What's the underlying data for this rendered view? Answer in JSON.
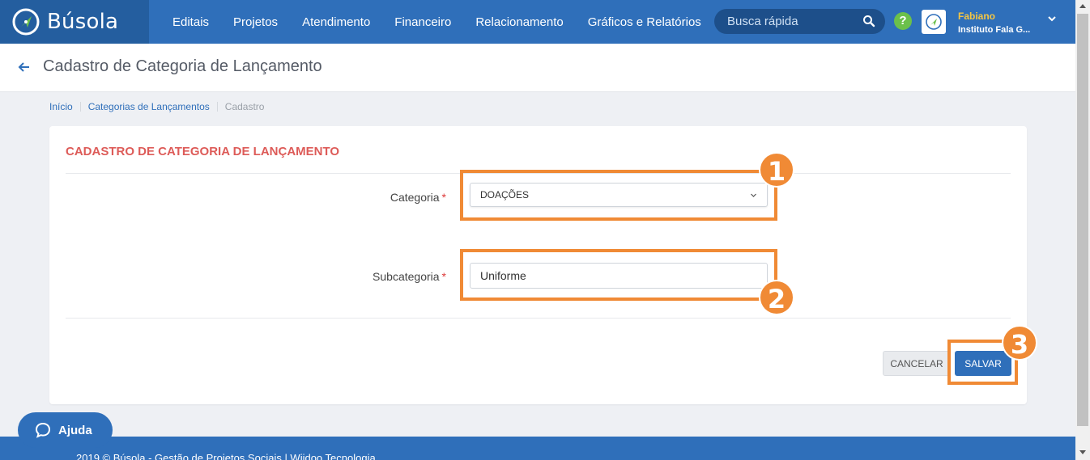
{
  "app": {
    "name": "Búsola"
  },
  "nav": {
    "items": [
      {
        "label": "Editais"
      },
      {
        "label": "Projetos"
      },
      {
        "label": "Atendimento"
      },
      {
        "label": "Financeiro"
      },
      {
        "label": "Relacionamento"
      },
      {
        "label": "Gráficos e Relatórios"
      }
    ]
  },
  "search": {
    "placeholder": "Busca rápida"
  },
  "user": {
    "name": "Fabiano",
    "org": "Instituto Fala G..."
  },
  "page": {
    "title": "Cadastro de Categoria de Lançamento"
  },
  "breadcrumb": [
    {
      "label": "Início"
    },
    {
      "label": "Categorias de Lançamentos"
    },
    {
      "label": "Cadastro"
    }
  ],
  "form": {
    "heading": "CADASTRO DE CATEGORIA DE LANÇAMENTO",
    "categoria": {
      "label": "Categoria",
      "required_mark": "*",
      "value": "DOAÇÕES"
    },
    "subcategoria": {
      "label": "Subcategoria",
      "required_mark": "*",
      "value": "Uniforme"
    },
    "cancel_label": "CANCELAR",
    "save_label": "SALVAR"
  },
  "annotations": {
    "n1": "1",
    "n2": "2",
    "n3": "3"
  },
  "help": {
    "label": "Ajuda"
  },
  "footer": {
    "text": "2019 © Búsola - Gestão de Projetos Sociais  |  Wiidoo Tecnologia"
  },
  "colors": {
    "primary": "#2f6fba",
    "brand_dark": "#245e9f",
    "heading_red": "#dd5b58",
    "annotation_orange": "#f08a35",
    "user_name_yellow": "#f6c642",
    "help_green": "#6bc04b"
  },
  "icons": [
    "compass-logo-icon",
    "search-icon",
    "help-icon",
    "user-avatar-icon",
    "chevron-down-icon",
    "back-arrow-icon",
    "chat-bubble-icon"
  ]
}
